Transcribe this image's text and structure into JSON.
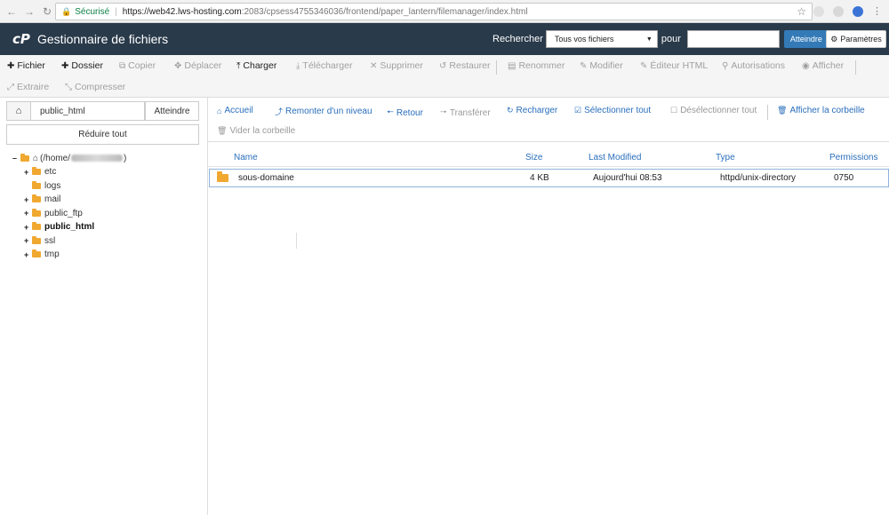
{
  "browser": {
    "secure_label": "Sécurisé",
    "url_host": "https://web42.lws-hosting.com",
    "url_path": ":2083/cpsess4755346036/frontend/paper_lantern/filemanager/index.html"
  },
  "header": {
    "logo": "cP",
    "title": "Gestionnaire de fichiers",
    "search_label": "Rechercher",
    "search_scope": "Tous vos fichiers",
    "for_label": "pour",
    "search_value": "",
    "go_label": "Atteindre",
    "settings_label": "Paramètres"
  },
  "toolbar": {
    "file": "Fichier",
    "folder": "Dossier",
    "copy": "Copier",
    "move": "Déplacer",
    "upload": "Charger",
    "download": "Télécharger",
    "delete": "Supprimer",
    "restore": "Restaurer",
    "rename": "Renommer",
    "edit": "Modifier",
    "html_editor": "Éditeur HTML",
    "permissions": "Autorisations",
    "view": "Afficher",
    "extract": "Extraire",
    "compress": "Compresser"
  },
  "left": {
    "path_value": "public_html",
    "go_label": "Atteindre",
    "collapse_label": "Réduire tout",
    "root_label_prefix": "(/home/",
    "root_label_suffix": ")",
    "folders": [
      "etc",
      "logs",
      "mail",
      "public_ftp",
      "public_html",
      "ssl",
      "tmp"
    ]
  },
  "actions": {
    "home": "Accueil",
    "up": "Remonter d'un niveau",
    "back": "Retour",
    "forward": "Transférer",
    "reload": "Recharger",
    "select_all": "Sélectionner tout",
    "deselect_all": "Désélectionner tout",
    "show_trash": "Afficher la corbeille",
    "empty_trash": "Vider la corbeille"
  },
  "table": {
    "headers": {
      "name": "Name",
      "size": "Size",
      "modified": "Last Modified",
      "type": "Type",
      "perms": "Permissions"
    },
    "rows": [
      {
        "name": "sous-domaine",
        "size": "4 KB",
        "modified": "Aujourd'hui 08:53",
        "type": "httpd/unix-directory",
        "perms": "0750"
      }
    ]
  }
}
